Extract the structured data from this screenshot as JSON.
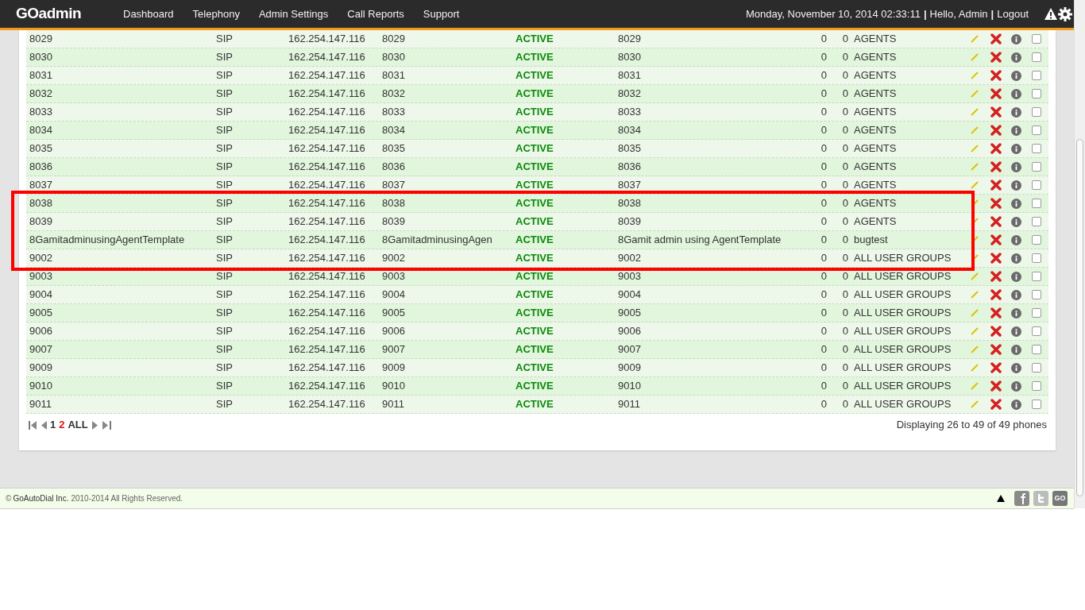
{
  "header": {
    "logo": "GOadmin",
    "nav": [
      {
        "label": "Dashboard"
      },
      {
        "label": "Telephony"
      },
      {
        "label": "Admin Settings"
      },
      {
        "label": "Call Reports"
      },
      {
        "label": "Support"
      }
    ],
    "datetime": "Monday, November 10, 2014 02:33:11",
    "separator": "|",
    "greeting": "Hello, Admin",
    "logout": "Logout"
  },
  "table": {
    "rows": [
      {
        "cells": [
          "8029",
          "SIP",
          "162.254.147.116",
          "8029",
          "ACTIVE",
          "8029",
          "0",
          "0",
          "AGENTS"
        ],
        "checked": false,
        "highlighted": false
      },
      {
        "cells": [
          "8030",
          "SIP",
          "162.254.147.116",
          "8030",
          "ACTIVE",
          "8030",
          "0",
          "0",
          "AGENTS"
        ],
        "checked": false,
        "highlighted": false
      },
      {
        "cells": [
          "8031",
          "SIP",
          "162.254.147.116",
          "8031",
          "ACTIVE",
          "8031",
          "0",
          "0",
          "AGENTS"
        ],
        "checked": false,
        "highlighted": false
      },
      {
        "cells": [
          "8032",
          "SIP",
          "162.254.147.116",
          "8032",
          "ACTIVE",
          "8032",
          "0",
          "0",
          "AGENTS"
        ],
        "checked": false,
        "highlighted": false
      },
      {
        "cells": [
          "8033",
          "SIP",
          "162.254.147.116",
          "8033",
          "ACTIVE",
          "8033",
          "0",
          "0",
          "AGENTS"
        ],
        "checked": false,
        "highlighted": false
      },
      {
        "cells": [
          "8034",
          "SIP",
          "162.254.147.116",
          "8034",
          "ACTIVE",
          "8034",
          "0",
          "0",
          "AGENTS"
        ],
        "checked": false,
        "highlighted": false
      },
      {
        "cells": [
          "8035",
          "SIP",
          "162.254.147.116",
          "8035",
          "ACTIVE",
          "8035",
          "0",
          "0",
          "AGENTS"
        ],
        "checked": false,
        "highlighted": false
      },
      {
        "cells": [
          "8036",
          "SIP",
          "162.254.147.116",
          "8036",
          "ACTIVE",
          "8036",
          "0",
          "0",
          "AGENTS"
        ],
        "checked": false,
        "highlighted": false
      },
      {
        "cells": [
          "8037",
          "SIP",
          "162.254.147.116",
          "8037",
          "ACTIVE",
          "8037",
          "0",
          "0",
          "AGENTS"
        ],
        "checked": false,
        "highlighted": false
      },
      {
        "cells": [
          "8038",
          "SIP",
          "162.254.147.116",
          "8038",
          "ACTIVE",
          "8038",
          "0",
          "0",
          "AGENTS"
        ],
        "checked": false,
        "highlighted": true
      },
      {
        "cells": [
          "8039",
          "SIP",
          "162.254.147.116",
          "8039",
          "ACTIVE",
          "8039",
          "0",
          "0",
          "AGENTS"
        ],
        "checked": false,
        "highlighted": true
      },
      {
        "cells": [
          "8GamitadminusingAgentTemplate",
          "SIP",
          "162.254.147.116",
          "8GamitadminusingAgen",
          "ACTIVE",
          "8Gamit admin using AgentTemplate",
          "0",
          "0",
          "bugtest"
        ],
        "checked": false,
        "highlighted": true
      },
      {
        "cells": [
          "9002",
          "SIP",
          "162.254.147.116",
          "9002",
          "ACTIVE",
          "9002",
          "0",
          "0",
          "ALL USER GROUPS"
        ],
        "checked": false,
        "highlighted": true
      },
      {
        "cells": [
          "9003",
          "SIP",
          "162.254.147.116",
          "9003",
          "ACTIVE",
          "9003",
          "0",
          "0",
          "ALL USER GROUPS"
        ],
        "checked": false,
        "highlighted": false
      },
      {
        "cells": [
          "9004",
          "SIP",
          "162.254.147.116",
          "9004",
          "ACTIVE",
          "9004",
          "0",
          "0",
          "ALL USER GROUPS"
        ],
        "checked": false,
        "highlighted": false
      },
      {
        "cells": [
          "9005",
          "SIP",
          "162.254.147.116",
          "9005",
          "ACTIVE",
          "9005",
          "0",
          "0",
          "ALL USER GROUPS"
        ],
        "checked": false,
        "highlighted": false
      },
      {
        "cells": [
          "9006",
          "SIP",
          "162.254.147.116",
          "9006",
          "ACTIVE",
          "9006",
          "0",
          "0",
          "ALL USER GROUPS"
        ],
        "checked": false,
        "highlighted": false
      },
      {
        "cells": [
          "9007",
          "SIP",
          "162.254.147.116",
          "9007",
          "ACTIVE",
          "9007",
          "0",
          "0",
          "ALL USER GROUPS"
        ],
        "checked": false,
        "highlighted": false
      },
      {
        "cells": [
          "9009",
          "SIP",
          "162.254.147.116",
          "9009",
          "ACTIVE",
          "9009",
          "0",
          "0",
          "ALL USER GROUPS"
        ],
        "checked": false,
        "highlighted": false
      },
      {
        "cells": [
          "9010",
          "SIP",
          "162.254.147.116",
          "9010",
          "ACTIVE",
          "9010",
          "0",
          "0",
          "ALL USER GROUPS"
        ],
        "checked": false,
        "highlighted": false
      },
      {
        "cells": [
          "9011",
          "SIP",
          "162.254.147.116",
          "9011",
          "ACTIVE",
          "9011",
          "0",
          "0",
          "ALL USER GROUPS"
        ],
        "checked": false,
        "highlighted": false
      }
    ]
  },
  "pagination": {
    "pages": [
      {
        "label": "1",
        "selected": false
      },
      {
        "label": "2",
        "selected": true
      },
      {
        "label": "ALL",
        "selected": false
      }
    ],
    "summary": "Displaying 26 to 49 of 49 phones"
  },
  "footer": {
    "copyright": "©",
    "company": "GoAutoDial Inc.",
    "rights": "2010-2014 All Rights Reserved.",
    "go_badge": "GO"
  }
}
